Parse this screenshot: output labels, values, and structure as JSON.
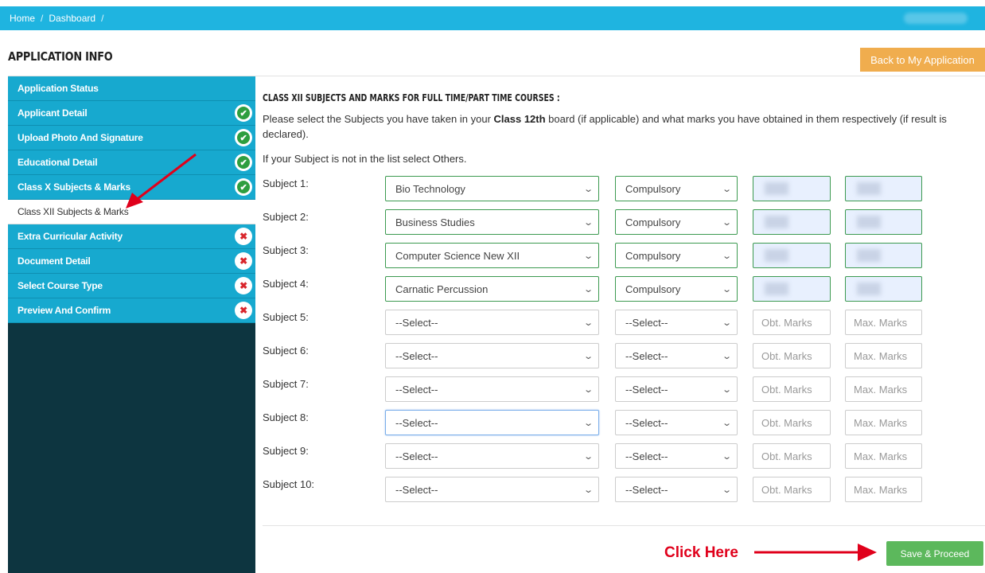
{
  "breadcrumb": {
    "items": [
      "Home",
      "Dashboard"
    ],
    "separator": "/"
  },
  "page": {
    "title": "APPLICATION INFO",
    "back_button": "Back to My Application"
  },
  "sidebar": {
    "items": [
      {
        "label": "Application Status",
        "status": "none"
      },
      {
        "label": "Applicant Detail",
        "status": "complete",
        "icon": "check-icon"
      },
      {
        "label": "Upload Photo And Signature",
        "status": "complete",
        "icon": "check-icon"
      },
      {
        "label": "Educational Detail",
        "status": "complete",
        "icon": "check-icon"
      },
      {
        "label": "Class X Subjects & Marks",
        "status": "complete",
        "icon": "check-icon"
      },
      {
        "label": "Class XII Subjects & Marks",
        "status": "active"
      },
      {
        "label": "Extra Curricular Activity",
        "status": "incomplete",
        "icon": "cross-icon"
      },
      {
        "label": "Document Detail",
        "status": "incomplete",
        "icon": "cross-icon"
      },
      {
        "label": "Select Course Type",
        "status": "incomplete",
        "icon": "cross-icon"
      },
      {
        "label": "Preview And Confirm",
        "status": "incomplete",
        "icon": "cross-icon"
      }
    ]
  },
  "section": {
    "title": "CLASS XII SUBJECTS AND MARKS FOR FULL TIME/PART TIME COURSES :",
    "intro_pre": "Please select the Subjects you have taken in your ",
    "intro_bold": "Class 12th",
    "intro_post": " board (if applicable) and what marks you have obtained in them respectively (if result is declared).",
    "intro2": "If your Subject is not in the list select Others."
  },
  "placeholders": {
    "obt": "Obt. Marks",
    "max": "Max. Marks"
  },
  "rows": [
    {
      "label": "Subject 1:",
      "subject": "Bio Technology",
      "type": "Compulsory",
      "filled": true
    },
    {
      "label": "Subject 2:",
      "subject": "Business Studies",
      "type": "Compulsory",
      "filled": true
    },
    {
      "label": "Subject 3:",
      "subject": "Computer Science New XII",
      "type": "Compulsory",
      "filled": true
    },
    {
      "label": "Subject 4:",
      "subject": "Carnatic Percussion",
      "type": "Compulsory",
      "filled": true
    },
    {
      "label": "Subject 5:",
      "subject": "--Select--",
      "type": "--Select--",
      "filled": false
    },
    {
      "label": "Subject 6:",
      "subject": "--Select--",
      "type": "--Select--",
      "filled": false
    },
    {
      "label": "Subject 7:",
      "subject": "--Select--",
      "type": "--Select--",
      "filled": false
    },
    {
      "label": "Subject 8:",
      "subject": "--Select--",
      "type": "--Select--",
      "filled": false,
      "focused": true
    },
    {
      "label": "Subject 9:",
      "subject": "--Select--",
      "type": "--Select--",
      "filled": false
    },
    {
      "label": "Subject 10:",
      "subject": "--Select--",
      "type": "--Select--",
      "filled": false
    }
  ],
  "actions": {
    "save_button": "Save & Proceed"
  },
  "annotations": {
    "click_here": "Click Here",
    "color": "#e0001b"
  },
  "colors": {
    "header": "#1fb4e0",
    "sidebar_item": "#17a9cf",
    "sidebar_bg": "#0d3540",
    "back_button": "#f0ad4e",
    "save_button": "#5cb85c",
    "filled_border": "#3c9a50"
  }
}
